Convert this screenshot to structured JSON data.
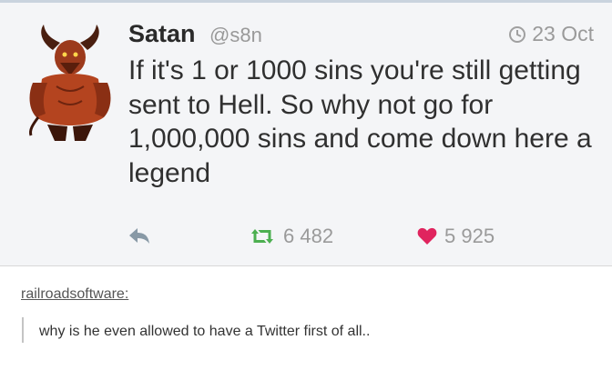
{
  "tweet": {
    "display_name": "Satan",
    "handle": "@s8n",
    "timestamp": "23 Oct",
    "body": "If it's 1 or 1000 sins you're still getting sent to Hell. So why not go for 1,000,000 sins and come down here a legend",
    "retweets": "6 482",
    "likes": "5 925"
  },
  "reblog": {
    "username": "railroadsoftware:",
    "comment": "why is he even allowed to have a Twitter first of all.."
  },
  "colors": {
    "heart": "#e0245e",
    "retweet": "#4caf50",
    "reply": "#8899a6"
  },
  "icons": [
    "avatar-devil",
    "clock-icon",
    "reply-icon",
    "retweet-icon",
    "heart-icon"
  ]
}
